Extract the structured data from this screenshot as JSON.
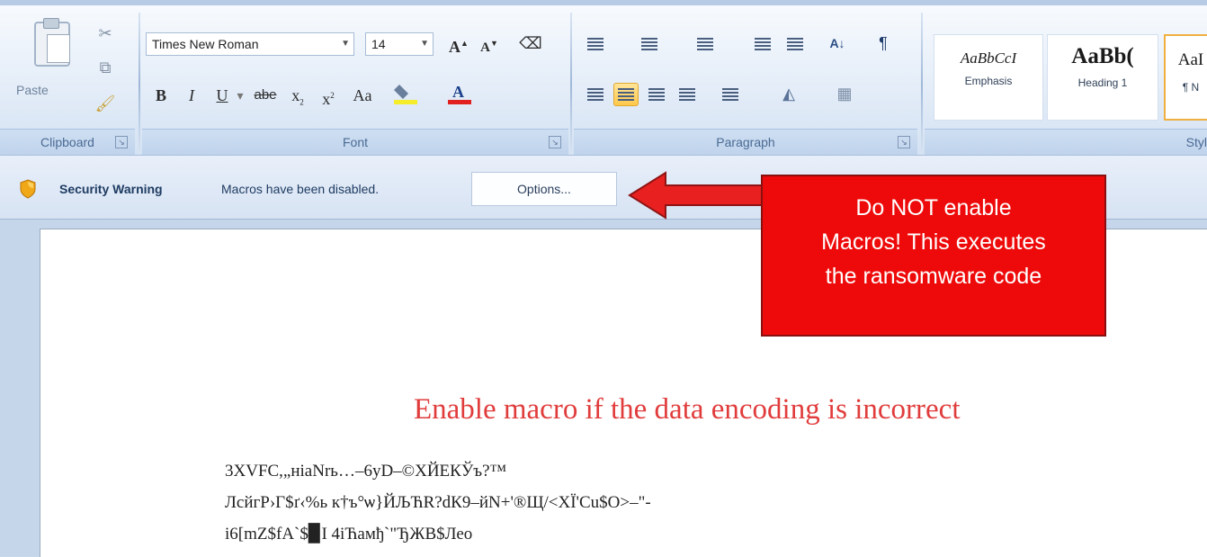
{
  "ribbon": {
    "clipboard": {
      "paste_label": "Paste",
      "group_label": "Clipboard",
      "icons": [
        "paste-icon",
        "cut-icon",
        "copy-icon",
        "format-painter-icon"
      ]
    },
    "font": {
      "font_name": "Times New Roman",
      "font_size": "14",
      "group_label": "Font",
      "grow_label": "A",
      "shrink_label": "A",
      "bold": "B",
      "italic": "I",
      "underline": "U",
      "strike": "abe",
      "subscript": "x",
      "superscript": "x",
      "change_case": "Aa"
    },
    "paragraph": {
      "group_label": "Paragraph",
      "pilcrow": "¶"
    },
    "styles": {
      "group_label": "Styl",
      "items": [
        {
          "sample": "AaBbCcI",
          "name": "Emphasis"
        },
        {
          "sample": "AaBb(",
          "name": "Heading 1"
        },
        {
          "sample": "AaI",
          "name": "¶ N"
        }
      ]
    }
  },
  "security_bar": {
    "title": "Security Warning",
    "message": "Macros have been disabled.",
    "options_label": "Options..."
  },
  "callout": {
    "lines": [
      "Do NOT enable",
      "Macros! This executes",
      "the ransomware code"
    ],
    "color": "#ee0a0a"
  },
  "document": {
    "heading": "Enable macro if the data encoding is incorrect",
    "garbled_lines": [
      "3XVFC,„ніaNrь…–6yD–©XЙЕКЎъ?™",
      "ЛсйгР›Г$ґ‹%ь к†ъ°ѡ}ЙЉЋR?dК9–йN+'®Щ/<ХЇ'Сu$О>–\"-",
      "i6[mZ$fA`$▉I 4іЋамђ`\"ЂЖВ$Лео"
    ],
    "heading_color": "#e13c3c"
  }
}
